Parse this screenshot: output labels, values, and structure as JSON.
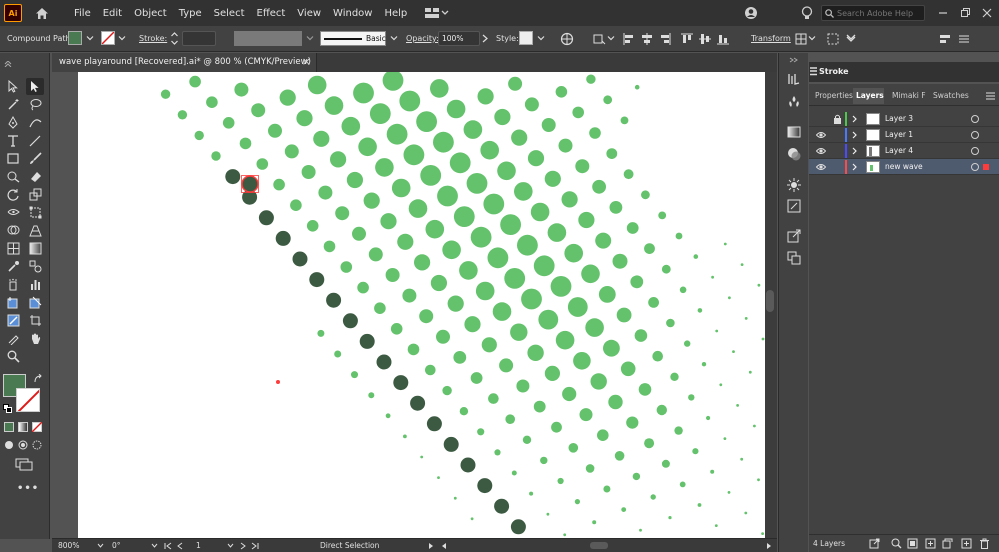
{
  "app": {
    "logo": "Ai"
  },
  "menu": [
    "File",
    "Edit",
    "Object",
    "Type",
    "Select",
    "Effect",
    "View",
    "Window",
    "Help"
  ],
  "search": {
    "placeholder": "Search Adobe Help"
  },
  "control_bar": {
    "selection_type": "Compound Path",
    "stroke_label": "Stroke:",
    "brush_label": "Basic",
    "opacity_label": "Opacity:",
    "opacity_value": "100%",
    "style_label": "Style:",
    "transform_label": "Transform",
    "fill_color": "#4a7a52"
  },
  "document": {
    "tab_title": "wave playaround [Recovered].ai* @ 800 % (CMYK/Preview)",
    "close_glyph": "×"
  },
  "status_bar": {
    "zoom": "800%",
    "rotation": "0°",
    "artboard": "1",
    "tool": "Direct Selection"
  },
  "panels": {
    "stroke_title": "Stroke",
    "tabs": [
      "Properties",
      "Layers",
      "Mimaki F",
      "Swatches"
    ],
    "active_tab": "Layers",
    "layers": [
      {
        "name": "Layer 3",
        "color": "#4bc84b",
        "visible": false,
        "locked": true
      },
      {
        "name": "Layer 1",
        "color": "#4a78ff",
        "visible": true,
        "locked": false
      },
      {
        "name": "Layer 4",
        "color": "#4a4aff",
        "visible": true,
        "locked": false
      },
      {
        "name": "new wave",
        "color": "#ff4a4a",
        "visible": true,
        "locked": false,
        "selected": true
      }
    ],
    "layer_count": "4 Layers"
  },
  "colors": {
    "dot_light": "#63c26b",
    "dot_dark": "#3c5a42",
    "selection": "#ff3b3b",
    "fill_swatch": "#4a7a52"
  }
}
